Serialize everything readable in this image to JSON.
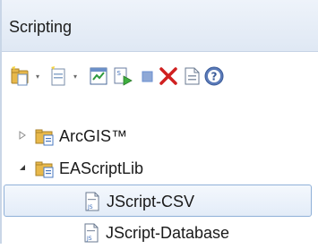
{
  "panel": {
    "title": "Scripting"
  },
  "toolbar": {
    "buttons": [
      {
        "name": "new-script-group-icon",
        "has_dropdown": true
      },
      {
        "name": "new-script-icon",
        "has_dropdown": true
      },
      {
        "name": "properties-icon",
        "has_dropdown": false
      },
      {
        "name": "run-script-icon",
        "has_dropdown": false
      },
      {
        "name": "stop-script-icon",
        "has_dropdown": false
      },
      {
        "name": "delete-icon",
        "has_dropdown": false
      },
      {
        "name": "document-icon",
        "has_dropdown": false
      },
      {
        "name": "help-icon",
        "has_dropdown": false
      }
    ]
  },
  "tree": {
    "items": [
      {
        "label": "ArcGIS™",
        "type": "folder",
        "expanded": false,
        "selected": false
      },
      {
        "label": "EAScriptLib",
        "type": "folder",
        "expanded": true,
        "selected": false
      },
      {
        "label": "JScript-CSV",
        "type": "script",
        "selected": true
      },
      {
        "label": "JScript-Database",
        "type": "script",
        "selected": false
      }
    ]
  },
  "colors": {
    "title_bar": "#dfe8f4",
    "selection_border": "#8fb0d8",
    "folder": "#e8b84a",
    "stop": "#6a8fd0",
    "delete": "#d02020"
  }
}
